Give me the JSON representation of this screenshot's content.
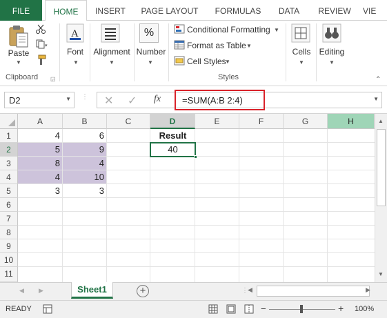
{
  "ribbon_tabs": [
    "FILE",
    "HOME",
    "INSERT",
    "PAGE LAYOUT",
    "FORMULAS",
    "DATA",
    "REVIEW",
    "VIE"
  ],
  "ribbon": {
    "paste_label": "Paste",
    "clipboard_label": "Clipboard",
    "font_label": "Font",
    "alignment_label": "Alignment",
    "number_label": "Number",
    "number_icon": "%",
    "conditional_formatting": "Conditional Formatting",
    "format_as_table": "Format as Table",
    "cell_styles": "Cell Styles",
    "styles_label": "Styles",
    "cells_label": "Cells",
    "editing_label": "Editing"
  },
  "formula_bar": {
    "name_box": "D2",
    "fx_symbol": "fx",
    "formula": "=SUM(A:B 2:4)"
  },
  "grid": {
    "columns": [
      "A",
      "B",
      "C",
      "D",
      "E",
      "F",
      "G",
      "H"
    ],
    "selected_column": "D",
    "highlighted_column": "H",
    "rows": [
      "1",
      "2",
      "3",
      "4",
      "5",
      "6",
      "7",
      "8",
      "9",
      "10",
      "11"
    ],
    "selected_row": "2",
    "data": {
      "A": [
        "4",
        "5",
        "8",
        "4",
        "3"
      ],
      "B": [
        "6",
        "9",
        "4",
        "10",
        "3"
      ]
    },
    "d1_header": "Result",
    "d2_value": "40"
  },
  "sheet_tab": "Sheet1",
  "status": {
    "ready": "READY",
    "zoom": "100%"
  },
  "colors": {
    "excel_green": "#217346",
    "selection_purple": "#cdc3db",
    "highlight_red": "#d9222a"
  }
}
